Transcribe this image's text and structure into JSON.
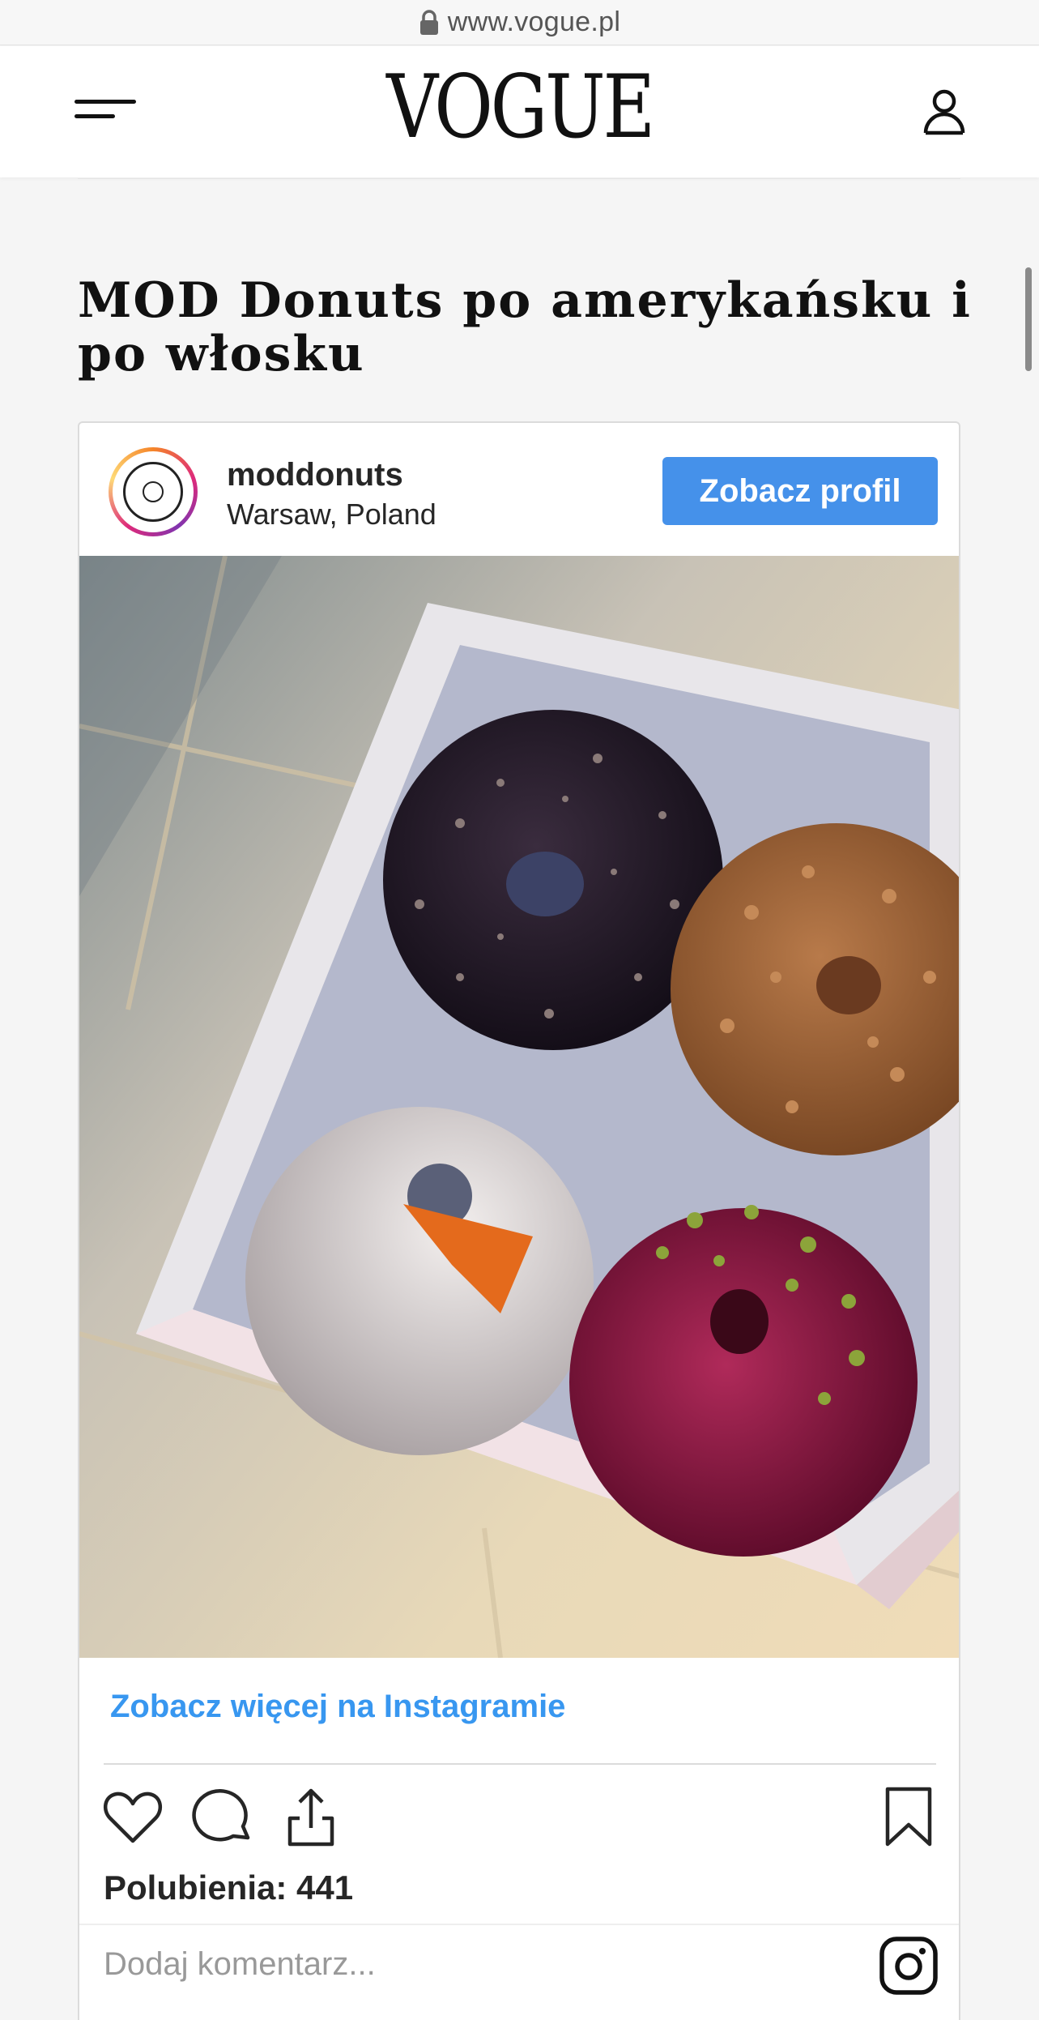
{
  "browser": {
    "url": "www.vogue.pl"
  },
  "header": {
    "logo": "VOGUE"
  },
  "article": {
    "title": "MOD Donuts po amerykańsku i po włosku"
  },
  "instagram": {
    "username": "moddonuts",
    "location": "Warsaw, Poland",
    "profile_button": "Zobacz profil",
    "see_more": "Zobacz więcej na Instagramie",
    "likes": "Polubienia: 441",
    "comment_placeholder": "Dodaj komentarz..."
  },
  "colors": {
    "accent": "#4591ea",
    "link": "#3897f0"
  }
}
